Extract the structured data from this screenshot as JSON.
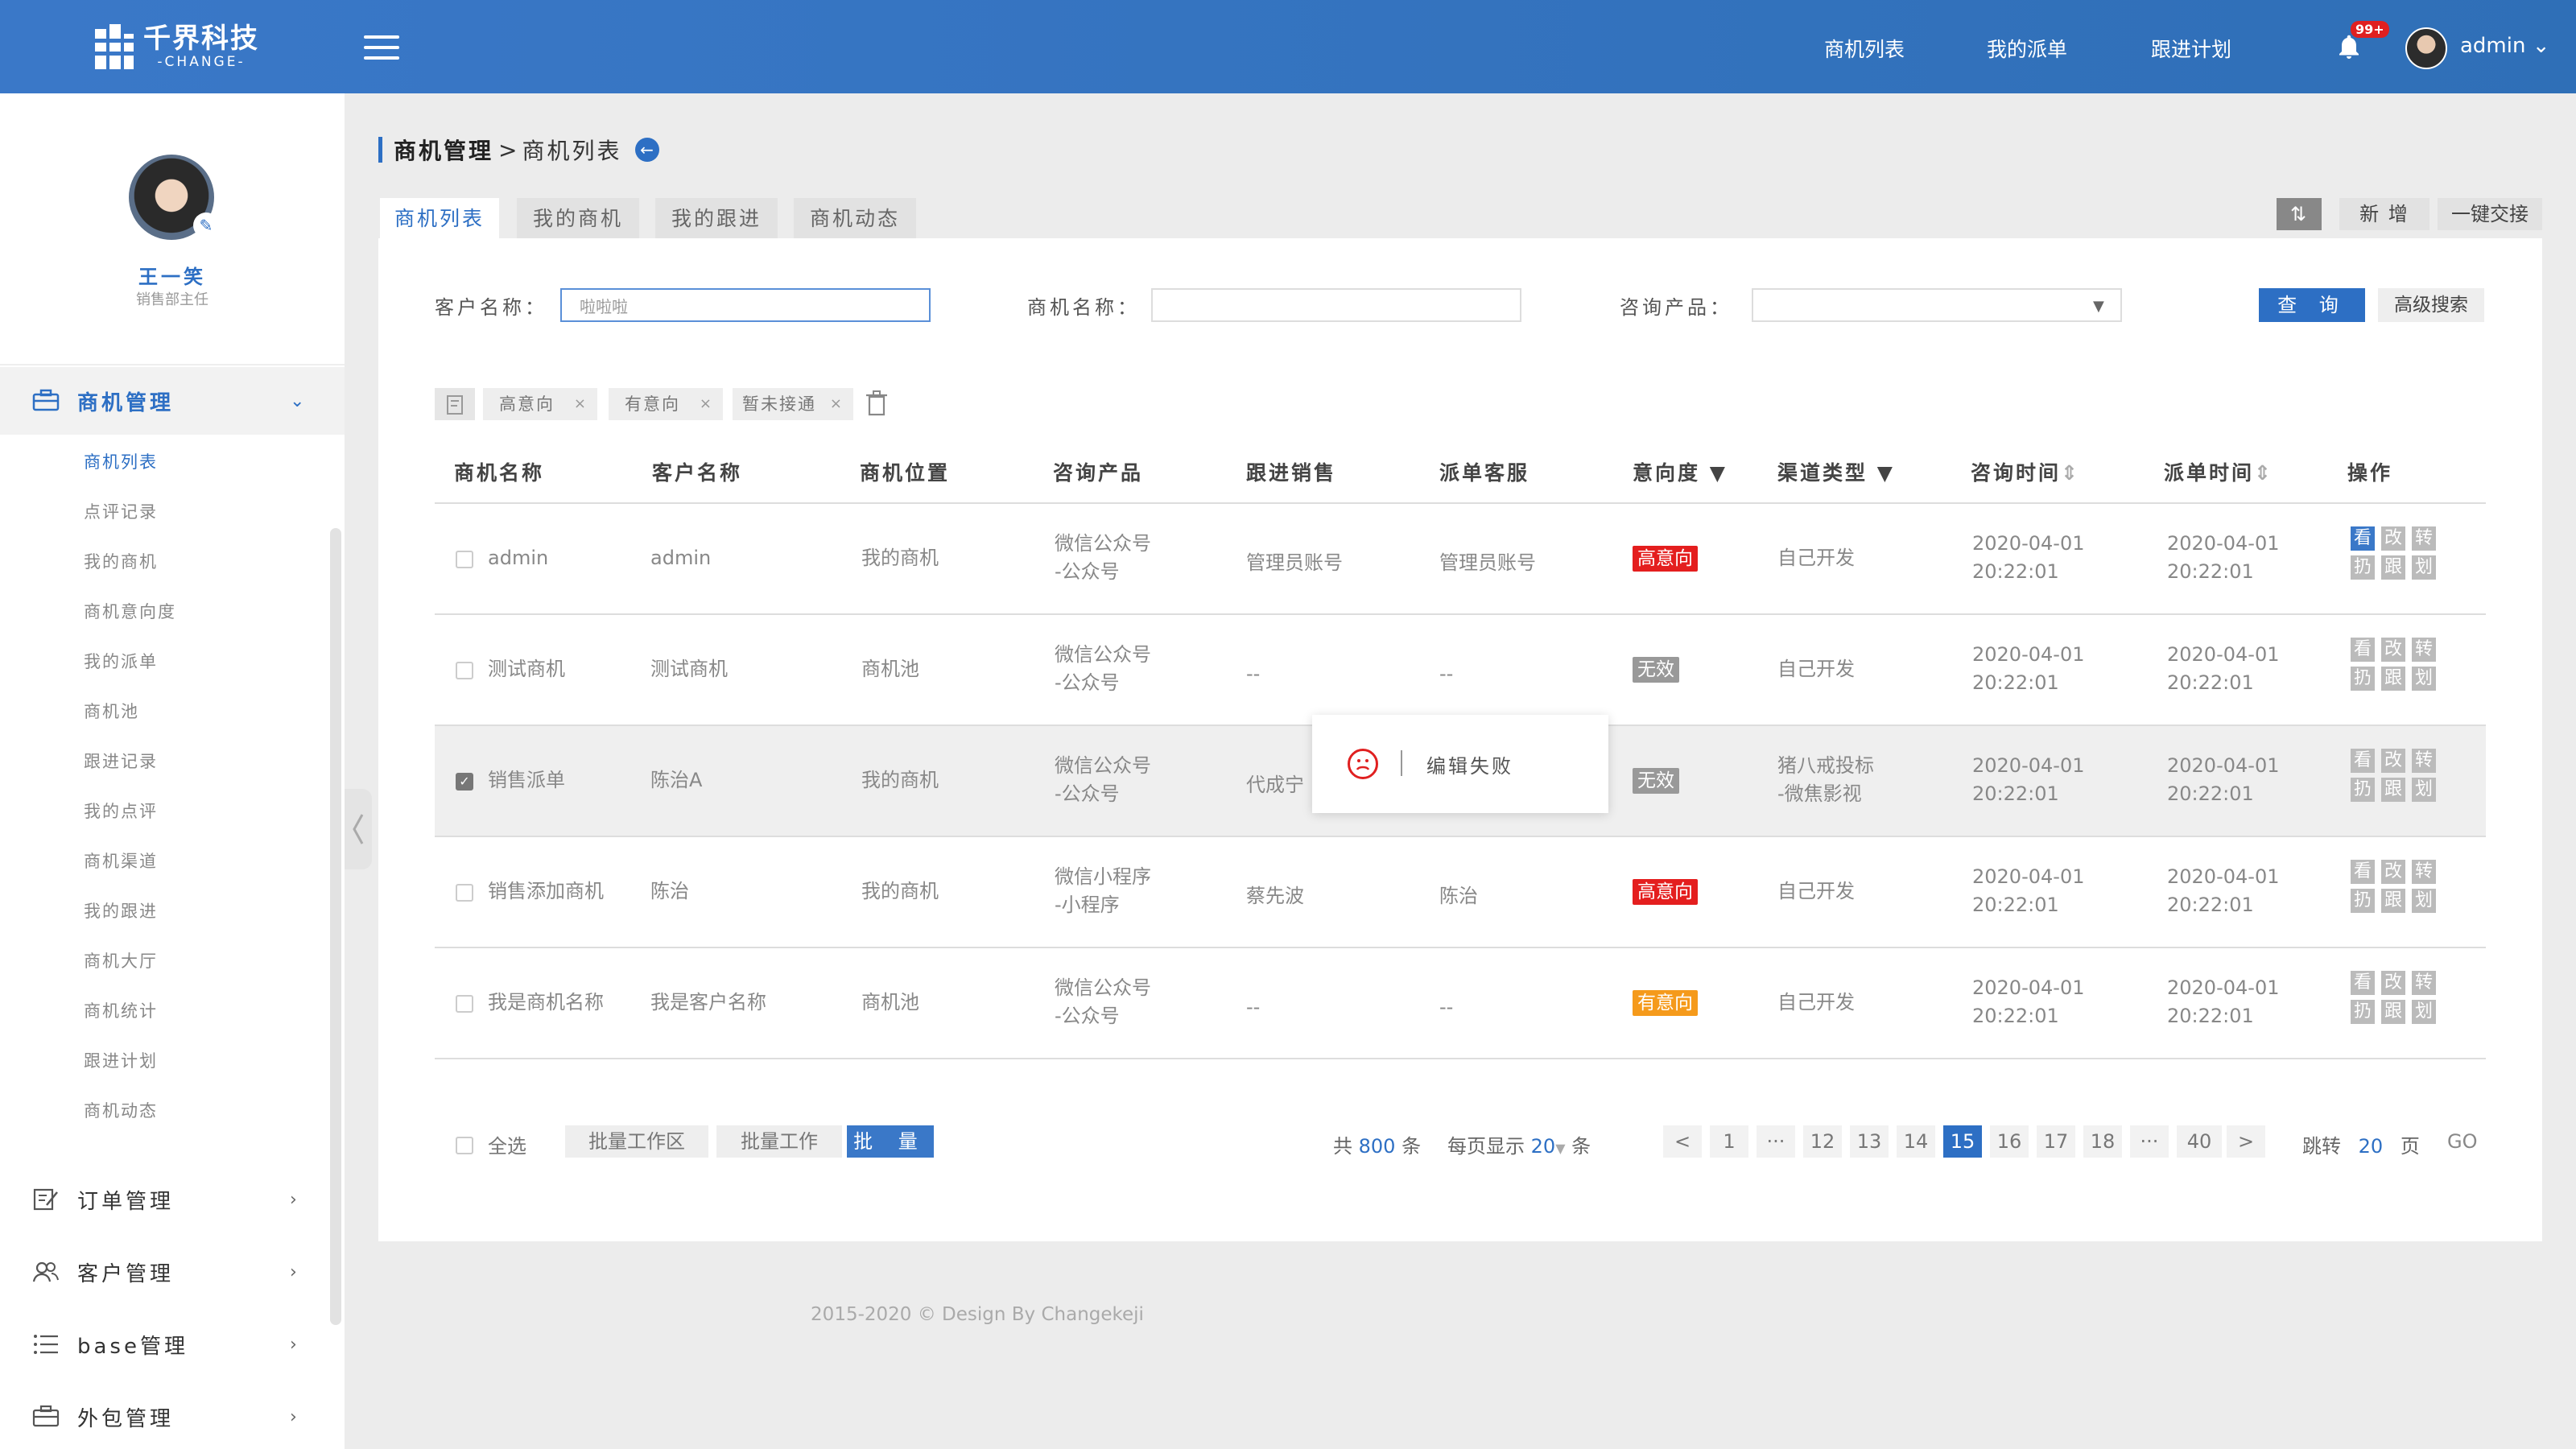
{
  "app": {
    "logo_cn": "千界科技",
    "logo_en": "-CHANGE-",
    "brand_color": "#2d6fc4"
  },
  "topnav": {
    "items": [
      "商机列表",
      "我的派单",
      "跟进计划"
    ],
    "badge": "99+",
    "username": "admin"
  },
  "profile": {
    "name": "王一笑",
    "role": "销售部主任"
  },
  "sidebar": {
    "groups": [
      {
        "label": "商机管理",
        "icon": "briefcase-icon",
        "expanded": true
      },
      {
        "label": "订单管理",
        "icon": "edit-icon"
      },
      {
        "label": "客户管理",
        "icon": "users-icon"
      },
      {
        "label": "base管理",
        "icon": "list-icon"
      },
      {
        "label": "外包管理",
        "icon": "briefcase-icon"
      }
    ],
    "sub_items": [
      "商机列表",
      "点评记录",
      "我的商机",
      "商机意向度",
      "我的派单",
      "商机池",
      "跟进记录",
      "我的点评",
      "商机渠道",
      "我的跟进",
      "商机大厅",
      "商机统计",
      "跟进计划",
      "商机动态"
    ]
  },
  "breadcrumb": {
    "parent": "商机管理",
    "separator": ">",
    "current": "商机列表"
  },
  "tabs": [
    "商机列表",
    "我的商机",
    "我的跟进",
    "商机动态"
  ],
  "toolbar": {
    "add": "新 增",
    "handover": "一键交接"
  },
  "filters": {
    "customer_label": "客户名称：",
    "customer_value": "啦啦啦",
    "opportunity_label": "商机名称：",
    "opportunity_value": "",
    "product_label": "咨询产品：",
    "product_value": "",
    "query": "查 询",
    "advanced": "高级搜索"
  },
  "chips": [
    "高意向",
    "有意向",
    "暂未接通"
  ],
  "table": {
    "headers": [
      "商机名称",
      "客户名称",
      "商机位置",
      "咨询产品",
      "跟进销售",
      "派单客服",
      "意向度",
      "渠道类型",
      "咨询时间",
      "派单时间",
      "操作"
    ],
    "rows": [
      {
        "name": "admin",
        "customer": "admin",
        "location": "我的商机",
        "product1": "微信公众号",
        "product2": "-公众号",
        "sales": "管理员账号",
        "service": "管理员账号",
        "intent": "高意向",
        "intent_color": "#e41e1e",
        "channel1": "自己开发",
        "channel2": "",
        "ctime1": "2020-04-01",
        "ctime2": "20:22:01",
        "dtime1": "2020-04-01",
        "dtime2": "20:22:01",
        "checked": false
      },
      {
        "name": "测试商机",
        "customer": "测试商机",
        "location": "商机池",
        "product1": "微信公众号",
        "product2": "-公众号",
        "sales": "--",
        "service": "--",
        "intent": "无效",
        "intent_color": "#999999",
        "channel1": "自己开发",
        "channel2": "",
        "ctime1": "2020-04-01",
        "ctime2": "20:22:01",
        "dtime1": "2020-04-01",
        "dtime2": "20:22:01",
        "checked": false
      },
      {
        "name": "销售派单",
        "customer": "陈治A",
        "location": "我的商机",
        "product1": "微信公众号",
        "product2": "-公众号",
        "sales": "代成宁",
        "service": "",
        "intent": "无效",
        "intent_color": "#999999",
        "channel1": "猪八戒投标",
        "channel2": "-微焦影视",
        "ctime1": "2020-04-01",
        "ctime2": "20:22:01",
        "dtime1": "2020-04-01",
        "dtime2": "20:22:01",
        "checked": true
      },
      {
        "name": "销售添加商机",
        "customer": "陈治",
        "location": "我的商机",
        "product1": "微信小程序",
        "product2": "-小程序",
        "sales": "蔡先波",
        "service": "陈治",
        "intent": "高意向",
        "intent_color": "#e41e1e",
        "channel1": "自己开发",
        "channel2": "",
        "ctime1": "2020-04-01",
        "ctime2": "20:22:01",
        "dtime1": "2020-04-01",
        "dtime2": "20:22:01",
        "checked": false
      },
      {
        "name": "我是商机名称",
        "customer": "我是客户名称",
        "location": "商机池",
        "product1": "微信公众号",
        "product2": "-公众号",
        "sales": "--",
        "service": "--",
        "intent": "有意向",
        "intent_color": "#f59a1b",
        "channel1": "自己开发",
        "channel2": "",
        "ctime1": "2020-04-01",
        "ctime2": "20:22:01",
        "dtime1": "2020-04-01",
        "dtime2": "20:22:01",
        "checked": false
      }
    ],
    "ops": [
      "看",
      "改",
      "转",
      "扔",
      "跟",
      "划"
    ]
  },
  "toast": {
    "message": "编辑失败"
  },
  "footer": {
    "select_all": "全选",
    "batch1": "批量工作区",
    "batch2": "批量工作",
    "batch3": "批 量",
    "total_prefix": "共",
    "total": "800",
    "total_suffix": "条",
    "per_page_label": "每页显示",
    "per_page": "20",
    "per_page_suffix": "条",
    "pages": [
      "<",
      "1",
      "···",
      "12",
      "13",
      "14",
      "15",
      "16",
      "17",
      "18",
      "···",
      "40",
      ">"
    ],
    "current_page": "15",
    "jump_label": "跳转",
    "jump_value": "20",
    "jump_suffix": "页",
    "go": "GO"
  },
  "copyright": "2015-2020 © Design By Changekeji"
}
